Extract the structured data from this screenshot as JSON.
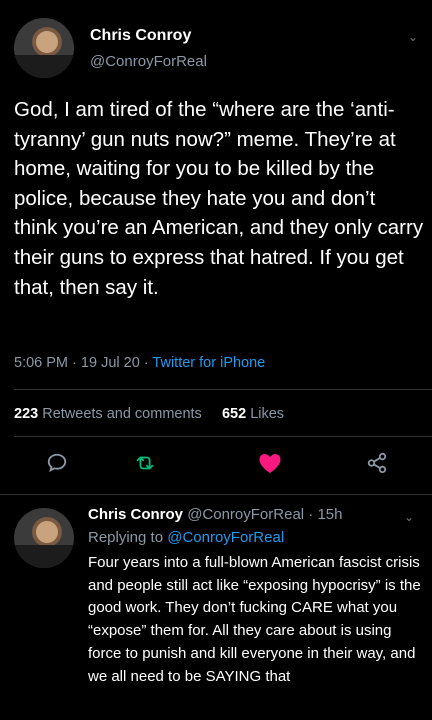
{
  "main_tweet": {
    "author_name": "Chris Conroy",
    "author_handle": "@ConroyForReal",
    "text": "God, I am tired of the “where are the ‘anti-tyranny’ gun nuts now?” meme. They’re at home, waiting for you to be killed by the police, because they hate you and don’t think you’re an American, and they only carry their guns to express that hatred. If you get that, then say it.",
    "time": "5:06 PM",
    "date": "19 Jul 20",
    "separator": "·",
    "source": "Twitter for iPhone",
    "retweets_count": "223",
    "retweets_label": "Retweets and comments",
    "likes_count": "652",
    "likes_label": "Likes"
  },
  "actions": {
    "reply_icon": "reply-icon",
    "retweet_icon": "retweet-icon",
    "like_icon": "heart-icon",
    "share_icon": "share-icon",
    "like_color": "#f91880",
    "retweet_color": "#00ba7c"
  },
  "reply_tweet": {
    "author_name": "Chris Conroy",
    "author_handle": "@ConroyForReal",
    "time": "15h",
    "replying_prefix": "Replying to",
    "replying_handle": "@ConroyForReal",
    "text": "Four years into a full-blown American fascist crisis and people still act like “exposing hypocrisy” is the good work. They don’t fucking CARE what you “expose” them for. All they care about is using force to punish and kill everyone in their way, and we all need to be SAYING that"
  },
  "colors": {
    "background": "#000000",
    "text": "#ffffff",
    "secondary": "#8b98a5",
    "link": "#1d9bf0"
  }
}
